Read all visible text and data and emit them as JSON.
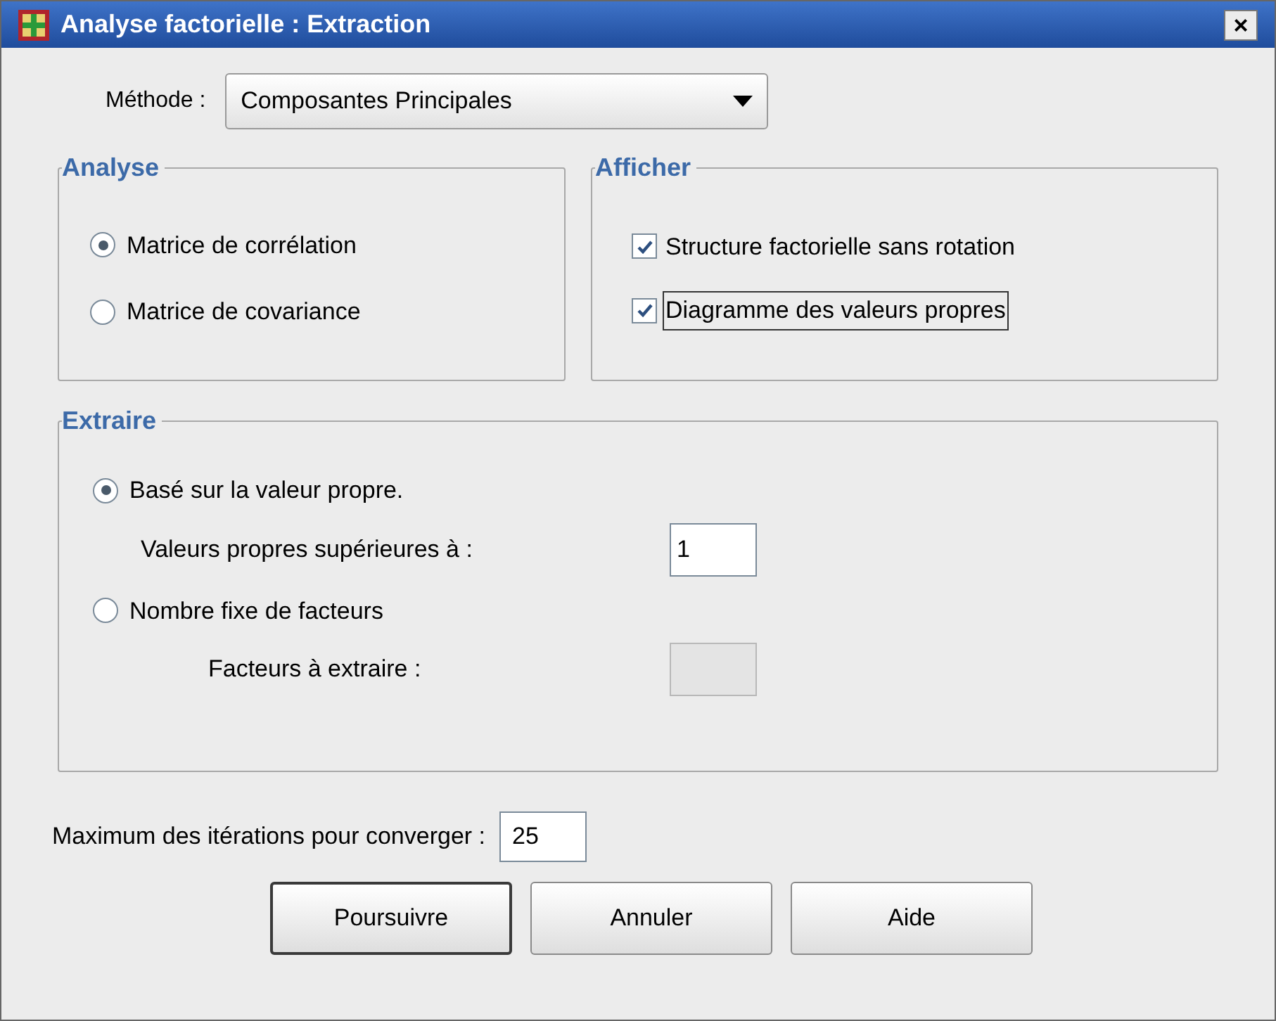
{
  "window": {
    "title": "Analyse factorielle : Extraction",
    "close": "×"
  },
  "method": {
    "label": "Méthode :",
    "value": "Composantes Principales"
  },
  "analyse": {
    "title": "Analyse",
    "options": [
      {
        "label": "Matrice de corrélation",
        "selected": true
      },
      {
        "label": "Matrice de covariance",
        "selected": false
      }
    ]
  },
  "afficher": {
    "title": "Afficher",
    "options": [
      {
        "label": "Structure factorielle sans rotation",
        "checked": true,
        "focused": false
      },
      {
        "label": "Diagramme des valeurs propres",
        "checked": true,
        "focused": true
      }
    ]
  },
  "extraire": {
    "title": "Extraire",
    "options": [
      {
        "label": "Basé sur la valeur propre.",
        "selected": true,
        "field_label": "Valeurs propres supérieures à :",
        "field_value": "1",
        "field_disabled": false
      },
      {
        "label": "Nombre fixe de facteurs",
        "selected": false,
        "field_label": "Facteurs à extraire :",
        "field_disabled": true
      }
    ]
  },
  "iterations": {
    "label": "Maximum des itérations pour converger :",
    "value": "25"
  },
  "buttons": [
    {
      "label": "Poursuivre",
      "default": true
    },
    {
      "label": "Annuler",
      "default": false
    },
    {
      "label": "Aide",
      "default": false
    }
  ]
}
